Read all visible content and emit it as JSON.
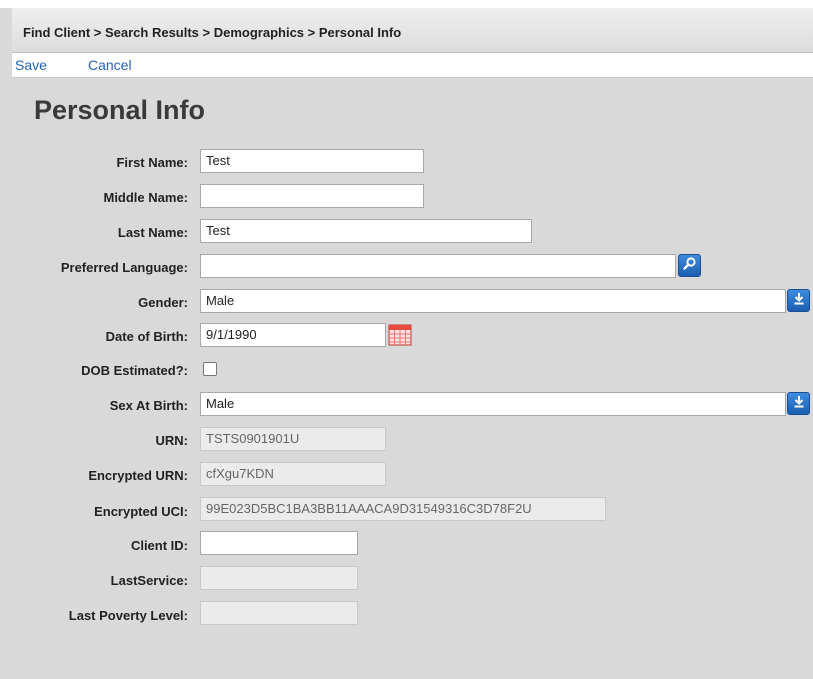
{
  "breadcrumb": "Find Client > Search Results > Demographics > Personal Info",
  "toolbar": {
    "save": "Save",
    "cancel": "Cancel"
  },
  "page_title": "Personal Info",
  "fields": {
    "first_name": {
      "label": "First Name:",
      "value": "Test"
    },
    "middle_name": {
      "label": "Middle Name:",
      "value": ""
    },
    "last_name": {
      "label": "Last Name:",
      "value": "Test"
    },
    "preferred_language": {
      "label": "Preferred Language:",
      "value": ""
    },
    "gender": {
      "label": "Gender:",
      "value": "Male"
    },
    "date_of_birth": {
      "label": "Date of Birth:",
      "value": "9/1/1990"
    },
    "dob_estimated": {
      "label": "DOB Estimated?:",
      "checked": false
    },
    "sex_at_birth": {
      "label": "Sex At Birth:",
      "value": "Male"
    },
    "urn": {
      "label": "URN:",
      "value": "TSTS0901901U"
    },
    "encrypted_urn": {
      "label": "Encrypted URN:",
      "value": "cfXgu7KDN"
    },
    "encrypted_uci": {
      "label": "Encrypted UCI:",
      "value": "99E023D5BC1BA3BB11AAACA9D31549316C3D78F2U"
    },
    "client_id": {
      "label": "Client ID:",
      "value": ""
    },
    "last_service": {
      "label": "LastService:",
      "value": ""
    },
    "last_poverty_level": {
      "label": "Last Poverty Level:",
      "value": ""
    }
  },
  "icons": {
    "language_lookup": "search-icon",
    "dropdown": "download-arrow-icon",
    "date_picker": "calendar-icon"
  },
  "colors": {
    "link": "#2463b5",
    "button_blue": "#2a74c9",
    "background": "#d9d9d9"
  }
}
